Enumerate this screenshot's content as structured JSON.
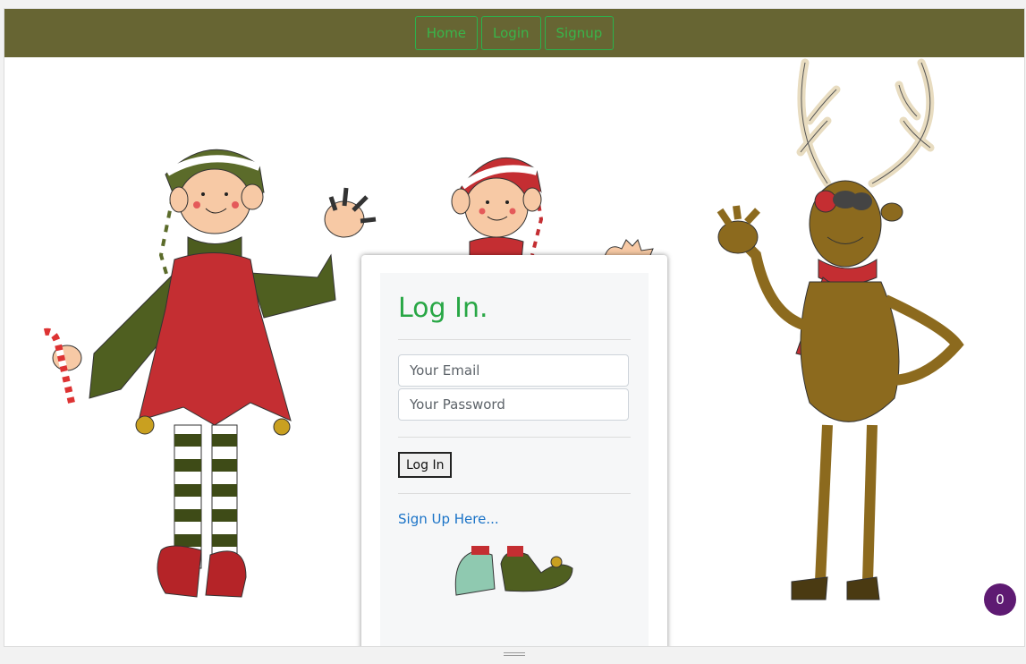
{
  "nav": {
    "items": [
      {
        "label": "Home"
      },
      {
        "label": "Login"
      },
      {
        "label": "Signup"
      }
    ]
  },
  "login": {
    "title": "Log In.",
    "email_placeholder": "Your Email",
    "password_placeholder": "Your Password",
    "submit_label": "Log In",
    "signup_link": "Sign Up Here..."
  },
  "badge": {
    "count": "0"
  },
  "colors": {
    "navbar": "#676533",
    "nav_accent": "#39b54a",
    "title": "#28a745",
    "link": "#1a73c7",
    "badge": "#5e1a72"
  }
}
